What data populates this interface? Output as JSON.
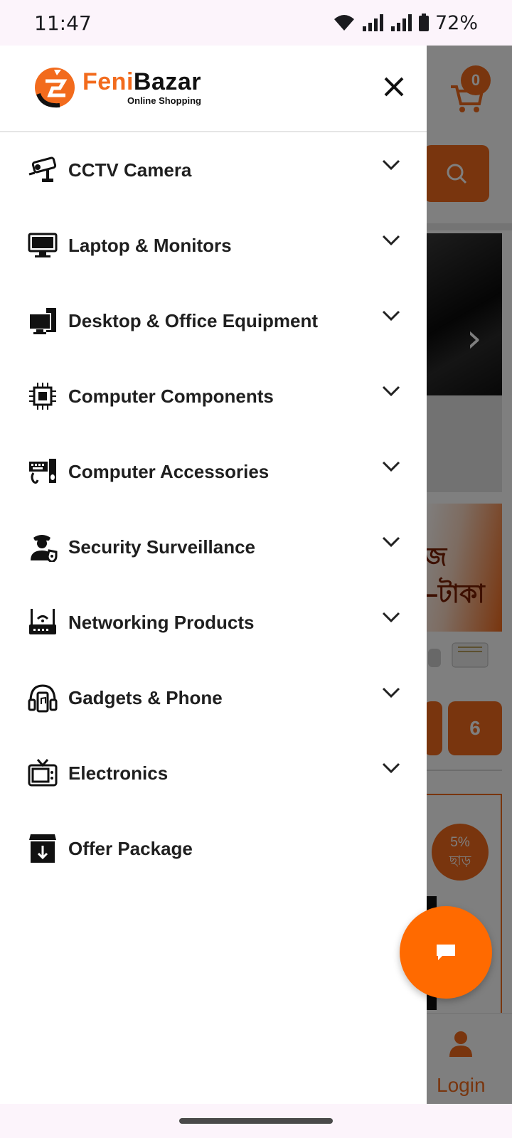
{
  "status_bar": {
    "time": "11:47",
    "battery": "72%"
  },
  "drawer": {
    "logo": {
      "brand_part1": "Feni",
      "brand_part2": "Bazar",
      "tagline": "Online Shopping"
    },
    "menu": [
      {
        "label": "CCTV Camera",
        "icon": "cctv-camera-icon",
        "expandable": true
      },
      {
        "label": "Laptop & Monitors",
        "icon": "monitor-icon",
        "expandable": true
      },
      {
        "label": "Desktop & Office Equipment",
        "icon": "desktop-icon",
        "expandable": true
      },
      {
        "label": "Computer Components",
        "icon": "cpu-chip-icon",
        "expandable": true
      },
      {
        "label": "Computer Accessories",
        "icon": "keyboard-mouse-icon",
        "expandable": true
      },
      {
        "label": "Security Surveillance",
        "icon": "security-guard-icon",
        "expandable": true
      },
      {
        "label": "Networking Products",
        "icon": "router-icon",
        "expandable": true
      },
      {
        "label": "Gadgets & Phone",
        "icon": "headphones-phone-icon",
        "expandable": true
      },
      {
        "label": "Electronics",
        "icon": "tv-icon",
        "expandable": true
      },
      {
        "label": "Offer Package",
        "icon": "package-icon",
        "expandable": false
      }
    ]
  },
  "background_page": {
    "cart_count": "0",
    "promo_line1": "জ",
    "promo_line2": "–টাকা",
    "pagination_next": "6",
    "discount_line1": "5%",
    "discount_line2": "ছাড়",
    "login_label": "Login"
  },
  "colors": {
    "accent": "#f26b1d",
    "fab": "#ff6a00",
    "text": "#1f1f1f"
  }
}
